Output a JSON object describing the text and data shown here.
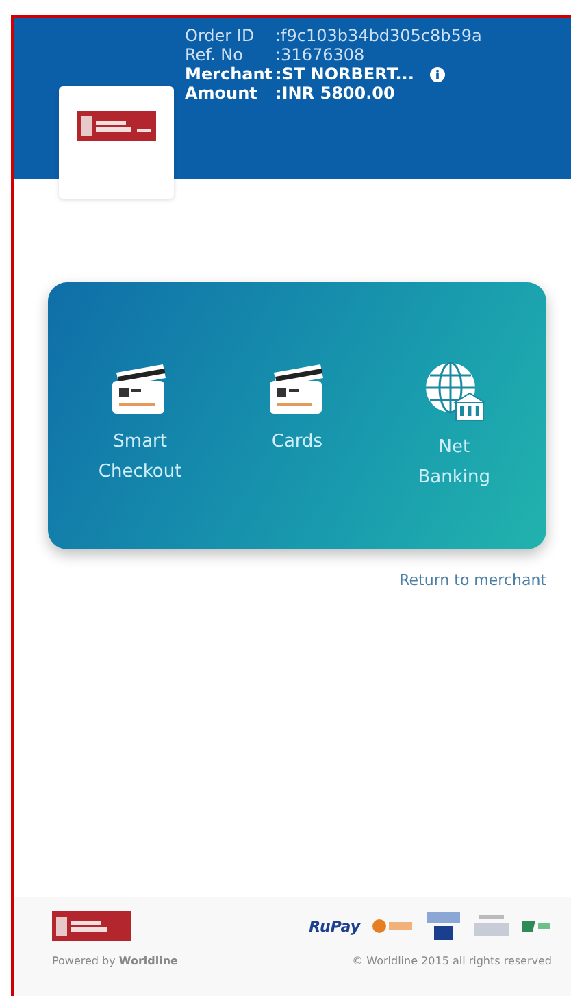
{
  "order": {
    "fields": [
      {
        "label": "Order ID",
        "value": ":f9c103b34bd305c8b59a",
        "bold": false
      },
      {
        "label": "Ref. No",
        "value": ":31676308",
        "bold": false
      },
      {
        "label": "Merchant",
        "value": ":ST NORBERT...",
        "bold": true,
        "info": true
      },
      {
        "label": "Amount",
        "value": ":INR 5800.00",
        "bold": true
      }
    ]
  },
  "payment_options": [
    {
      "kind": "card",
      "label": "Smart Checkout"
    },
    {
      "kind": "card",
      "label": "Cards"
    },
    {
      "kind": "bank",
      "label": "Net Banking"
    }
  ],
  "return_link": "Return to merchant",
  "footer": {
    "powered_by": "Powered by **Worldline**",
    "copyright": "© Worldline 2015 all rights reserved",
    "rupay": "RuPay"
  }
}
